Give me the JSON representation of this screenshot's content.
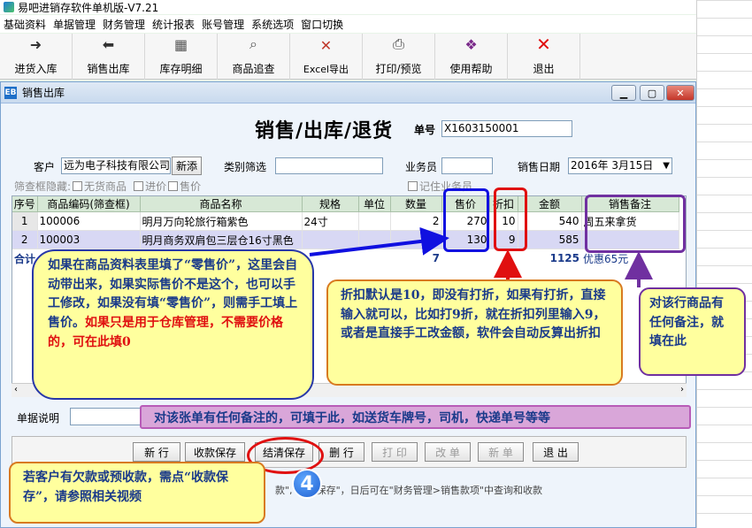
{
  "app": {
    "title": "易吧进销存软件单机版-V7.21"
  },
  "menu": [
    "基础资料",
    "单据管理",
    "财务管理",
    "统计报表",
    "账号管理",
    "系统选项",
    "窗口切换"
  ],
  "toolbar": [
    {
      "label": "进货入库",
      "icon": "stock-in-icon"
    },
    {
      "label": "销售出库",
      "icon": "sales-out-icon"
    },
    {
      "label": "库存明细",
      "icon": "inventory-icon"
    },
    {
      "label": "商品追查",
      "icon": "trace-icon"
    },
    {
      "label": "Excel导出",
      "icon": "excel-icon"
    },
    {
      "label": "打印/预览",
      "icon": "printer-icon"
    },
    {
      "label": "使用帮助",
      "icon": "help-book-icon"
    },
    {
      "label": "退出",
      "icon": "close-x-icon"
    }
  ],
  "window": {
    "title": "销售出库"
  },
  "form": {
    "heading": "销售/出库/退货",
    "order_no_label": "单号",
    "order_no": "X1603150001",
    "customer_label": "客户",
    "customer": "远为电子科技有限公司",
    "customer_button": "新添",
    "category_label": "类别筛选",
    "category": "",
    "staff_label": "业务员",
    "staff": "",
    "date_label": "销售日期",
    "date": "2016年 3月15日",
    "filter_hide_label": "筛查框隐藏:",
    "filter_no_stock": "无货商品",
    "filter_cost": "进价",
    "filter_price": "售价",
    "remember_staff": "记住业务员"
  },
  "grid": {
    "columns": [
      "序号",
      "商品编码(筛查框)",
      "商品名称",
      "规格",
      "单位",
      "数量",
      "售价",
      "折扣",
      "金额",
      "销售备注"
    ],
    "rows": [
      {
        "no": "1",
        "code": "100006",
        "name": "明月万向轮旅行箱紫色",
        "spec": "24寸",
        "unit": "",
        "qty": "2",
        "price": "270",
        "discount": "10",
        "amount": "540",
        "remark": "周五来拿货"
      },
      {
        "no": "2",
        "code": "100003",
        "name": "明月商务双肩包三层仓16寸黑色",
        "spec": "",
        "unit": "",
        "qty": "5",
        "price": "130",
        "discount": "9",
        "amount": "585",
        "remark": ""
      }
    ],
    "total_label": "合计",
    "total_qty": "7",
    "total_amount": "1125",
    "total_discount": "优惠65元"
  },
  "bottom": {
    "note_label": "单据说明",
    "note": "",
    "buttons": [
      {
        "label": "新 行",
        "enabled": true
      },
      {
        "label": "收款保存",
        "enabled": true
      },
      {
        "label": "结清保存",
        "enabled": true
      },
      {
        "label": "删 行",
        "enabled": true
      },
      {
        "label": "打 印",
        "enabled": false
      },
      {
        "label": "改 单",
        "enabled": false
      },
      {
        "label": "新 单",
        "enabled": false
      },
      {
        "label": "退 出",
        "enabled": true
      }
    ],
    "hint_text": "款\",\"收款保存\"，日后可在\"财务管理>销售款项\"中查询和收款"
  },
  "callouts": {
    "price": "如果在商品资料表里填了“零售价”，这里会自动带出来，如果实际售价不是这个，也可以手工修改，如果没有填“零售价”，则需手工填上售价。",
    "price_red": "如果只是用于仓库管理，不需要价格的，可在此填0",
    "discount": "折扣默认是10，即没有打折，如果有打折，直接输入就可以，比如打9折，就在折扣列里输入9，或者是直接手工改金额，软件会自动反算出折扣",
    "remark": "对该行商品有任何备注，就填在此",
    "note": "对该张单有任何备注的，可填于此，如送货车牌号，司机，快递单号等等",
    "payment": "若客户有欠款或预收款，需点“收款保存”，请参照相关视频",
    "step_number": "4"
  },
  "colors": {
    "highlight_blue": "#1010e0",
    "highlight_red": "#e01010",
    "highlight_purple": "#7030a0",
    "callout_bg": "#ffff9e"
  }
}
